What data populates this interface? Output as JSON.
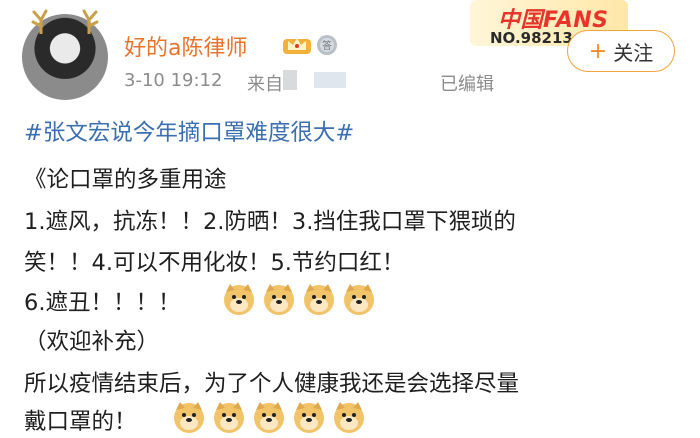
{
  "user": {
    "name": "好的a陈律师",
    "time": "3-10 19:12",
    "source_label": "来自",
    "edited_label": "已编辑"
  },
  "badge": {
    "title": "中国FANS",
    "number": "NO.98213"
  },
  "follow": {
    "plus": "+",
    "label": "关注"
  },
  "post": {
    "hashtag": "#张文宏说今年摘口罩难度很大#",
    "lines": [
      "《论口罩的多重用途",
      "1.遮风，抗冻！！2.防晒！3.挡住我口罩下猥琐的",
      "笑！！4.可以不用化妆！5.节约口红！",
      "6.遮丑！！！！",
      "（欢迎补充）",
      "所以疫情结束后，为了个人健康我还是会选择尽量",
      "戴口罩的！"
    ]
  },
  "colors": {
    "username": "#e8732a",
    "hashtag": "#3b6fb0",
    "follow_border": "#f0a43a",
    "meta": "#8c8c8c"
  },
  "icons": [
    "avatar-antler",
    "vip-crown-icon",
    "answer-medal-icon",
    "doge-emoji"
  ]
}
